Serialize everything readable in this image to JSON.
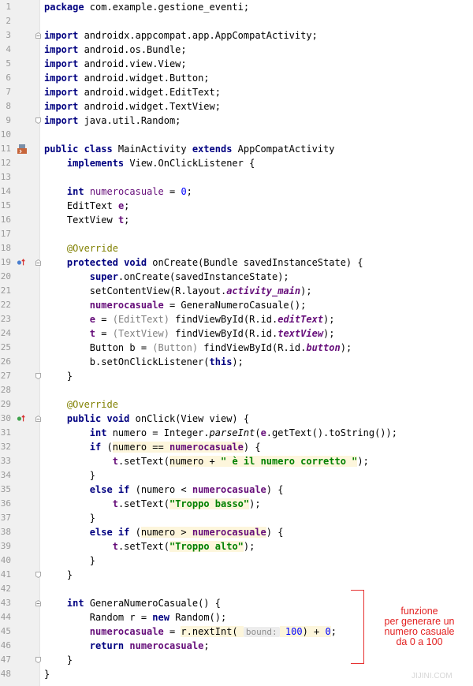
{
  "line_numbers": [
    "1",
    "2",
    "3",
    "4",
    "5",
    "6",
    "7",
    "8",
    "9",
    "10",
    "11",
    "12",
    "13",
    "14",
    "15",
    "16",
    "17",
    "18",
    "19",
    "20",
    "21",
    "22",
    "23",
    "24",
    "25",
    "26",
    "27",
    "28",
    "29",
    "30",
    "31",
    "32",
    "33",
    "34",
    "35",
    "36",
    "37",
    "38",
    "39",
    "40",
    "41",
    "42",
    "43",
    "44",
    "45",
    "46",
    "47",
    "48"
  ],
  "code": {
    "l1_kw": "package",
    "l1_rest": " com.example.gestione_eventi;",
    "import_kw": "import",
    "l3": " androidx.appcompat.app.AppCompatActivity;",
    "l4": " android.os.Bundle;",
    "l5": " android.view.View;",
    "l6": " android.widget.Button;",
    "l7": " android.widget.EditText;",
    "l8": " android.widget.TextView;",
    "l9": " java.util.Random;",
    "l11_kw1": "public class",
    "l11_mid": " MainActivity ",
    "l11_kw2": "extends",
    "l11_rest": " AppCompatActivity",
    "l12_kw": "implements",
    "l12_rest": " View.OnClickListener {",
    "l14_kw": "int",
    "l14_fld": "numerocasuale",
    "l14_eq": " = ",
    "l14_num": "0",
    "l14_end": ";",
    "l15_type": "EditText ",
    "l15_fld": "e",
    "l15_end": ";",
    "l16_type": "TextView ",
    "l16_fld": "t",
    "l16_end": ";",
    "override": "@Override",
    "l19_kw": "protected void",
    "l19_rest": " onCreate(Bundle savedInstanceState) {",
    "l20_kw": "super",
    "l20_rest": ".onCreate(savedInstanceState);",
    "l21_a": "setContentView(R.layout.",
    "l21_f": "activity_main",
    "l21_b": ");",
    "l22_fld": "numerocasuale",
    "l22_rest": " = GeneraNumeroCasuale();",
    "l23_fld": "e",
    "l23_a": " = ",
    "l23_cast": "(EditText)",
    "l23_b": " findViewById(R.id.",
    "l23_f": "editText",
    "l23_c": ");",
    "l24_fld": "t",
    "l24_a": " = ",
    "l24_cast": "(TextView)",
    "l24_b": " findViewById(R.id.",
    "l24_f": "textView",
    "l24_c": ");",
    "l25_a": "Button b = ",
    "l25_cast": "(Button)",
    "l25_b": " findViewById(R.id.",
    "l25_f": "button",
    "l25_c": ");",
    "l26_a": "b.setOnClickListener(",
    "l26_kw": "this",
    "l26_b": ");",
    "close": "}",
    "l30_kw": "public void",
    "l30_rest": " onClick(View view) {",
    "l31_kw": "int",
    "l31_a": " numero = Integer.",
    "l31_it": "parseInt",
    "l31_b": "(",
    "l31_fld": "e",
    "l31_c": ".getText().toString());",
    "l32_kw": "if",
    "l32_a": " (",
    "l32_hl": "numero == ",
    "l32_fld": "numerocasuale",
    "l32_b": ") {",
    "l33_fld": "t",
    "l33_a": ".setText(",
    "l33_hl": "numero + ",
    "l33_str": "\" è il numero corretto \"",
    "l33_b": ");",
    "l34": "}",
    "l35_kw": "else if",
    "l35_a": " (numero < ",
    "l35_fld": "numerocasuale",
    "l35_b": ") {",
    "l36_fld": "t",
    "l36_a": ".setText(",
    "l36_str": "\"Troppo basso\"",
    "l36_b": ");",
    "l38_kw": "else if",
    "l38_a": " (",
    "l38_hl": "numero > ",
    "l38_fld": "numerocasuale",
    "l38_b": ") {",
    "l39_fld": "t",
    "l39_a": ".setText(",
    "l39_str": "\"Troppo alto\"",
    "l39_b": ");",
    "l43_kw": "int",
    "l43_rest": " GeneraNumeroCasuale() {",
    "l44_a": "Random r = ",
    "l44_kw": "new",
    "l44_b": " Random();",
    "l45_fld": "numerocasuale",
    "l45_a": " = ",
    "l45_hl1": "r.nextInt(",
    "l45_hint": "bound:",
    "l45_num": "100",
    "l45_hl2": ") + ",
    "l45_num2": "0",
    "l45_end": ";",
    "l46_kw": "return",
    "l46_fld": "numerocasuale",
    "l46_end": ";"
  },
  "annotation": {
    "lines": [
      "funzione",
      "per generare un",
      "numero casuale",
      "da 0 a 100"
    ],
    "color": "#e22222"
  },
  "watermark": "JIJINI.COM",
  "colors": {
    "keyword": "#000080",
    "field": "#660e7a",
    "string": "#008000",
    "number": "#0000ff",
    "annotation": "#808000",
    "usage_highlight": "#fdf6dc"
  },
  "icons": {
    "line_11": "class-run-icon",
    "line_19": "override-method-icon",
    "line_30": "implement-method-icon"
  }
}
